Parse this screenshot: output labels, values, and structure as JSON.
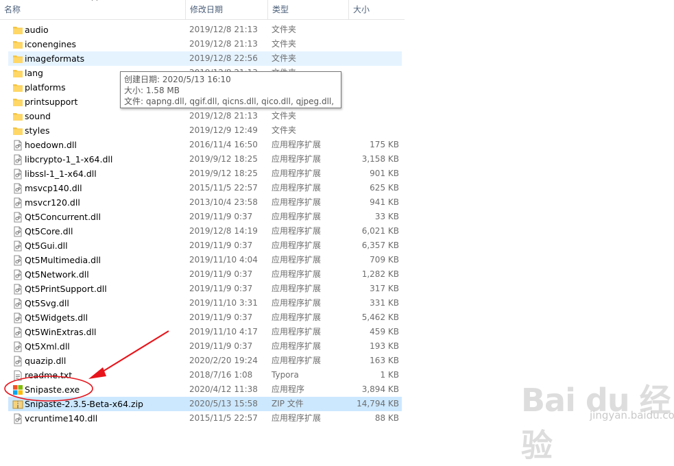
{
  "columns": {
    "name": "名称",
    "date": "修改日期",
    "type": "类型",
    "size": "大小"
  },
  "files": [
    {
      "icon": "folder-icon",
      "name": "audio",
      "date": "2019/12/8 21:13",
      "type": "文件夹",
      "size": ""
    },
    {
      "icon": "folder-icon",
      "name": "iconengines",
      "date": "2019/12/8 21:13",
      "type": "文件夹",
      "size": ""
    },
    {
      "icon": "folder-icon",
      "name": "imageformats",
      "date": "2019/12/8 22:56",
      "type": "文件夹",
      "size": "",
      "state": "hover"
    },
    {
      "icon": "folder-icon",
      "name": "lang",
      "date": "2019/12/8 21:13",
      "type": "文件夹",
      "size": ""
    },
    {
      "icon": "folder-icon",
      "name": "platforms",
      "date": "",
      "type": "",
      "size": ""
    },
    {
      "icon": "folder-icon",
      "name": "printsupport",
      "date": "",
      "type": "",
      "size": ""
    },
    {
      "icon": "folder-icon",
      "name": "sound",
      "date": "2019/12/8 21:13",
      "type": "文件夹",
      "size": ""
    },
    {
      "icon": "folder-icon",
      "name": "styles",
      "date": "2019/12/9 12:49",
      "type": "文件夹",
      "size": ""
    },
    {
      "icon": "dll-file-icon",
      "name": "hoedown.dll",
      "date": "2016/11/4 16:50",
      "type": "应用程序扩展",
      "size": "175 KB"
    },
    {
      "icon": "dll-file-icon",
      "name": "libcrypto-1_1-x64.dll",
      "date": "2019/9/12 18:25",
      "type": "应用程序扩展",
      "size": "3,158 KB"
    },
    {
      "icon": "dll-file-icon",
      "name": "libssl-1_1-x64.dll",
      "date": "2019/9/12 18:25",
      "type": "应用程序扩展",
      "size": "901 KB"
    },
    {
      "icon": "dll-file-icon",
      "name": "msvcp140.dll",
      "date": "2015/11/5 22:57",
      "type": "应用程序扩展",
      "size": "625 KB"
    },
    {
      "icon": "dll-file-icon",
      "name": "msvcr120.dll",
      "date": "2013/10/4 23:58",
      "type": "应用程序扩展",
      "size": "941 KB"
    },
    {
      "icon": "dll-file-icon",
      "name": "Qt5Concurrent.dll",
      "date": "2019/11/9 0:37",
      "type": "应用程序扩展",
      "size": "33 KB"
    },
    {
      "icon": "dll-file-icon",
      "name": "Qt5Core.dll",
      "date": "2019/12/8 14:19",
      "type": "应用程序扩展",
      "size": "6,021 KB"
    },
    {
      "icon": "dll-file-icon",
      "name": "Qt5Gui.dll",
      "date": "2019/11/9 0:37",
      "type": "应用程序扩展",
      "size": "6,357 KB"
    },
    {
      "icon": "dll-file-icon",
      "name": "Qt5Multimedia.dll",
      "date": "2019/11/10 4:04",
      "type": "应用程序扩展",
      "size": "709 KB"
    },
    {
      "icon": "dll-file-icon",
      "name": "Qt5Network.dll",
      "date": "2019/11/9 0:37",
      "type": "应用程序扩展",
      "size": "1,282 KB"
    },
    {
      "icon": "dll-file-icon",
      "name": "Qt5PrintSupport.dll",
      "date": "2019/11/9 0:37",
      "type": "应用程序扩展",
      "size": "317 KB"
    },
    {
      "icon": "dll-file-icon",
      "name": "Qt5Svg.dll",
      "date": "2019/11/10 3:31",
      "type": "应用程序扩展",
      "size": "331 KB"
    },
    {
      "icon": "dll-file-icon",
      "name": "Qt5Widgets.dll",
      "date": "2019/11/9 0:37",
      "type": "应用程序扩展",
      "size": "5,462 KB"
    },
    {
      "icon": "dll-file-icon",
      "name": "Qt5WinExtras.dll",
      "date": "2019/11/10 4:17",
      "type": "应用程序扩展",
      "size": "459 KB"
    },
    {
      "icon": "dll-file-icon",
      "name": "Qt5Xml.dll",
      "date": "2019/11/9 0:37",
      "type": "应用程序扩展",
      "size": "193 KB"
    },
    {
      "icon": "dll-file-icon",
      "name": "quazip.dll",
      "date": "2020/2/20 19:24",
      "type": "应用程序扩展",
      "size": "163 KB"
    },
    {
      "icon": "text-file-icon",
      "name": "readme.txt",
      "date": "2018/7/16 1:08",
      "type": "Typora",
      "size": "1 KB"
    },
    {
      "icon": "snipaste-app-icon",
      "name": "Snipaste.exe",
      "date": "2020/4/12 11:38",
      "type": "应用程序",
      "size": "3,894 KB"
    },
    {
      "icon": "zip-file-icon",
      "name": "Snipaste-2.3.5-Beta-x64.zip",
      "date": "2020/5/13 15:58",
      "type": "ZIP 文件",
      "size": "14,794 KB",
      "state": "selected"
    },
    {
      "icon": "dll-file-icon",
      "name": "vcruntime140.dll",
      "date": "2015/11/5 22:57",
      "type": "应用程序扩展",
      "size": "88 KB"
    }
  ],
  "tooltip": {
    "line1": "创建日期: 2020/5/13 16:10",
    "line2": "大小: 1.58 MB",
    "line3": "文件: qapng.dll, qgif.dll, qicns.dll, qico.dll, qjpeg.dll, ..."
  },
  "watermark": {
    "logo": "Bai du 经验",
    "url": "jingyan.baidu.com"
  },
  "colors": {
    "hover": "#e5f3ff",
    "selected": "#cce8ff",
    "annotation": "#e8141b",
    "folder": "#f4c542"
  }
}
